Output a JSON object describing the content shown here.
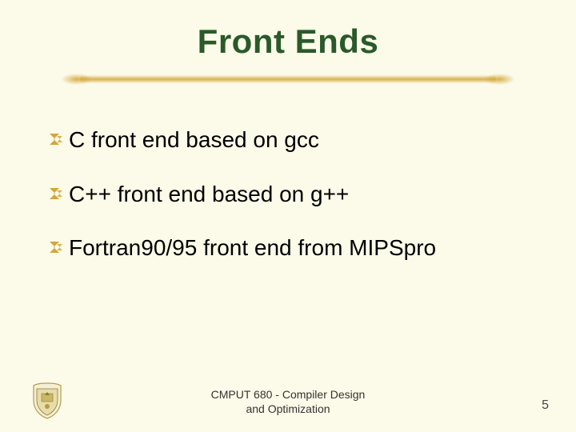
{
  "title": "Front Ends",
  "bullets": [
    "C front end based on gcc",
    "C++ front end based on g++",
    "Fortran90/95 front end from MIPSpro"
  ],
  "footer": {
    "line1": "CMPUT 680 - Compiler Design",
    "line2": "and Optimization"
  },
  "page_number": "5",
  "colors": {
    "background": "#fcfae8",
    "title": "#2a5a2a",
    "accent": "#d2a63c"
  }
}
